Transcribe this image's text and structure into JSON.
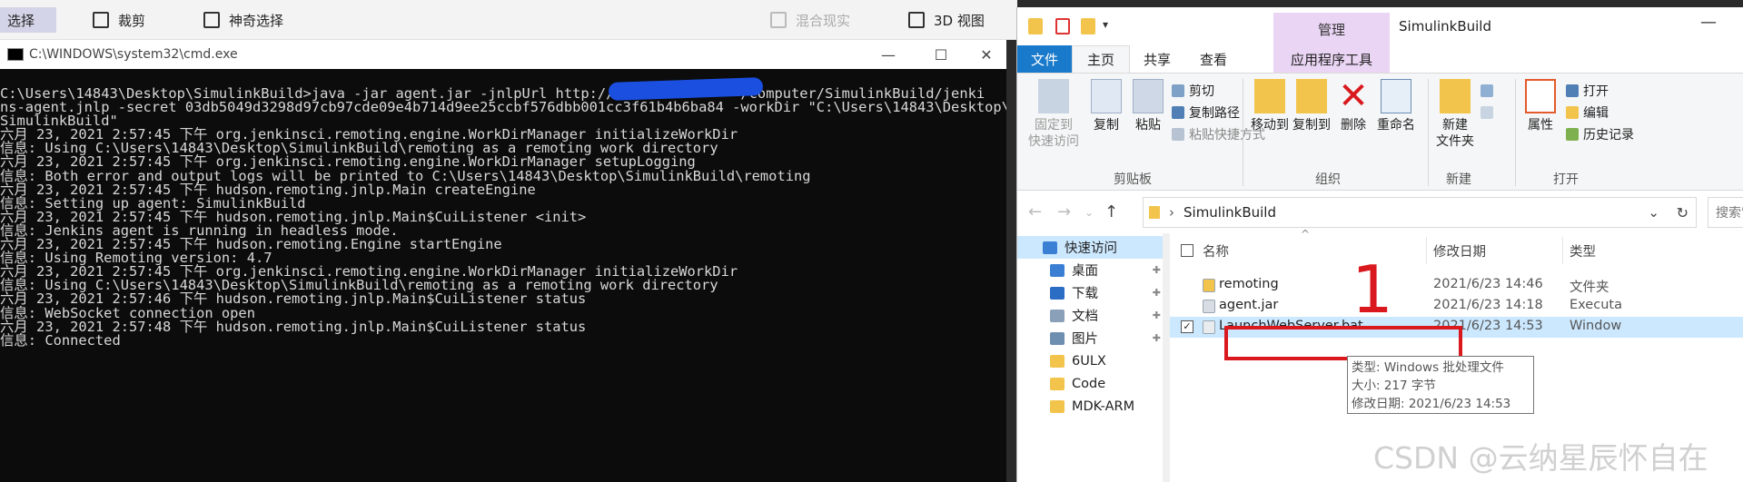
{
  "paint_toolbar": {
    "select": "选择",
    "crop": "裁剪",
    "magic_select": "神奇选择",
    "mixed_reality": "混合现实",
    "view_3d": "3D 视图"
  },
  "cmd": {
    "title": "C:\\WINDOWS\\system32\\cmd.exe",
    "minimize": "—",
    "maximize": "☐",
    "close": "✕",
    "lines": [
      "C:\\Users\\14843\\Desktop\\SimulinkBuild>java -jar agent.jar -jnlpUrl http://               /computer/SimulinkBuild/jenki",
      "ns-agent.jnlp -secret 03db5049d3298d97cb97cde09e4b714d9ee25ccbf576dbb001cc3f61b4b6ba84 -workDir \"C:\\Users\\14843\\Desktop\\",
      "SimulinkBuild\"",
      "六月 23, 2021 2:57:45 下午 org.jenkinsci.remoting.engine.WorkDirManager initializeWorkDir",
      "信息: Using C:\\Users\\14843\\Desktop\\SimulinkBuild\\remoting as a remoting work directory",
      "六月 23, 2021 2:57:45 下午 org.jenkinsci.remoting.engine.WorkDirManager setupLogging",
      "信息: Both error and output logs will be printed to C:\\Users\\14843\\Desktop\\SimulinkBuild\\remoting",
      "六月 23, 2021 2:57:45 下午 hudson.remoting.jnlp.Main createEngine",
      "信息: Setting up agent: SimulinkBuild",
      "六月 23, 2021 2:57:45 下午 hudson.remoting.jnlp.Main$CuiListener <init>",
      "信息: Jenkins agent is running in headless mode.",
      "六月 23, 2021 2:57:45 下午 hudson.remoting.Engine startEngine",
      "信息: Using Remoting version: 4.7",
      "六月 23, 2021 2:57:45 下午 org.jenkinsci.remoting.engine.WorkDirManager initializeWorkDir",
      "信息: Using C:\\Users\\14843\\Desktop\\SimulinkBuild\\remoting as a remoting work directory",
      "六月 23, 2021 2:57:46 下午 hudson.remoting.jnlp.Main$CuiListener status",
      "信息: WebSocket connection open",
      "六月 23, 2021 2:57:48 下午 hudson.remoting.jnlp.Main$CuiListener status",
      "信息: Connected"
    ]
  },
  "explorer": {
    "title": "SimulinkBuild",
    "manage_tab": "管理",
    "minimize": "—",
    "tabs": {
      "file": "文件",
      "home": "主页",
      "share": "共享",
      "view": "查看",
      "app_tools": "应用程序工具"
    },
    "ribbon": {
      "pin_quick": "固定到\n快速访问",
      "copy": "复制",
      "paste": "粘贴",
      "cut": "剪切",
      "copy_path": "复制路径",
      "paste_shortcut": "粘贴快捷方式",
      "group_clipboard": "剪贴板",
      "move_to": "移动到",
      "copy_to": "复制到",
      "delete": "删除",
      "rename": "重命名",
      "group_organize": "组织",
      "new_folder": "新建\n文件夹",
      "group_new": "新建",
      "properties": "属性",
      "open": "打开",
      "edit": "编辑",
      "history": "历史记录",
      "group_open": "打开"
    },
    "address": {
      "path": "SimulinkBuild",
      "search_placeholder": "搜索\"Simulin"
    },
    "nav": [
      {
        "label": "快速访问"
      },
      {
        "label": "桌面"
      },
      {
        "label": "下载"
      },
      {
        "label": "文档"
      },
      {
        "label": "图片"
      },
      {
        "label": "6ULX"
      },
      {
        "label": "Code"
      },
      {
        "label": "MDK-ARM"
      }
    ],
    "columns": {
      "name": "名称",
      "date": "修改日期",
      "type": "类型"
    },
    "files": [
      {
        "name": "remoting",
        "date": "2021/6/23 14:46",
        "type": "文件夹"
      },
      {
        "name": "agent.jar",
        "date": "2021/6/23 14:18",
        "type": "Executa"
      },
      {
        "name": "LaunchWebServer.bat",
        "date": "2021/6/23 14:53",
        "type": "Window"
      }
    ],
    "tooltip": {
      "type": "类型: Windows 批处理文件",
      "size": "大小: 217 字节",
      "modified": "修改日期: 2021/6/23 14:53"
    },
    "checkmark": "✓"
  },
  "annotation": {
    "label": "1"
  },
  "watermark": "CSDN @云纳星辰怀自在"
}
